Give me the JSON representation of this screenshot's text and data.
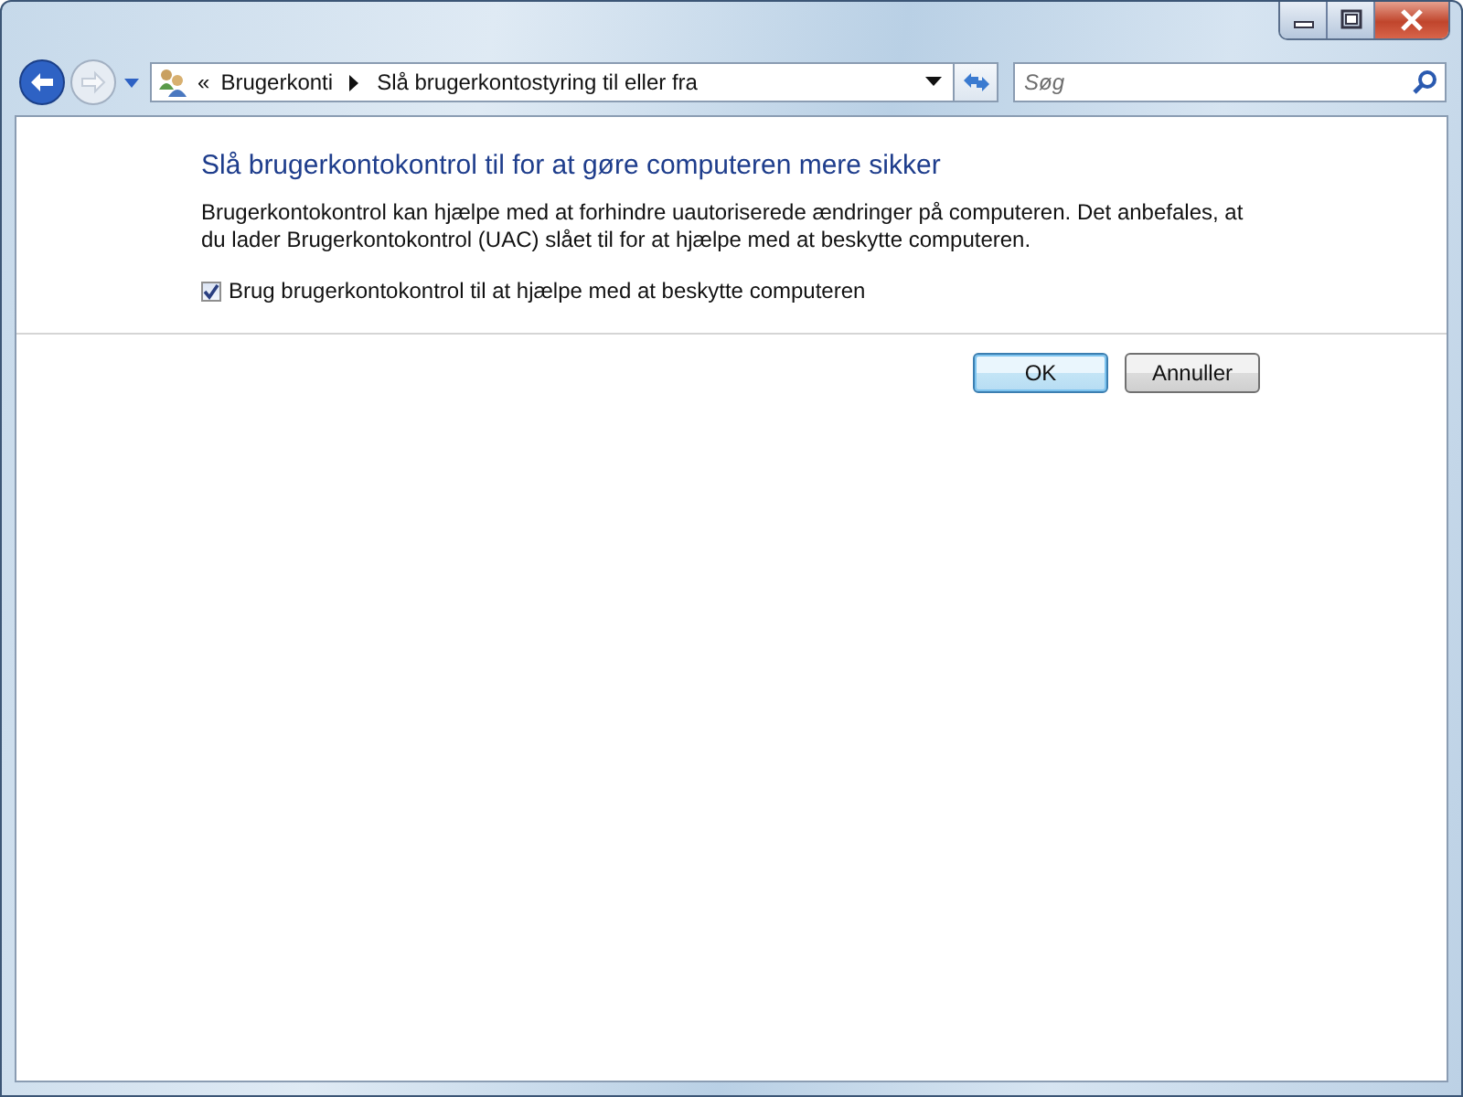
{
  "address_bar": {
    "overflow": "«",
    "breadcrumbs": [
      "Brugerkonti",
      "Slå brugerkontostyring til eller fra"
    ]
  },
  "search": {
    "placeholder": "Søg"
  },
  "content": {
    "heading": "Slå brugerkontokontrol til for at gøre computeren mere sikker",
    "description": "Brugerkontokontrol kan hjælpe med at forhindre uautoriserede ændringer på computeren. Det anbefales, at du lader Brugerkontokontrol (UAC) slået til for at hjælpe med at beskytte computeren.",
    "checkbox": {
      "label": "Brug brugerkontokontrol til at hjælpe med at beskytte computeren",
      "checked": true
    }
  },
  "buttons": [
    {
      "label": "OK",
      "default": true
    },
    {
      "label": "Annuller",
      "default": false
    }
  ]
}
